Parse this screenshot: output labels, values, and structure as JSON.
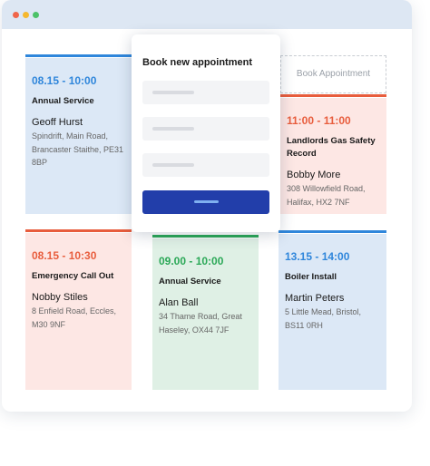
{
  "window": {
    "dots": [
      {
        "name": "close-dot",
        "color": "#f0654a"
      },
      {
        "name": "minimize-dot",
        "color": "#f5b82e"
      },
      {
        "name": "maximize-dot",
        "color": "#4cc268"
      }
    ]
  },
  "appointments": [
    {
      "time": "08.15 - 10:00",
      "service": "Annual Service",
      "name": "Geoff Hurst",
      "address": "Spindrift, Main Road, Brancaster Staithe, PE31 8BP",
      "accent": "#2f86db",
      "bg": "#dce8f6"
    },
    {
      "time": "11:00 - 11:00",
      "service": "Landlords Gas Safety Record",
      "name": "Bobby More",
      "address": "308 Willowfield Road, Halifax, HX2 7NF",
      "accent": "#e85d3d",
      "bg": "#fde7e4"
    },
    {
      "time": "08.15 - 10:30",
      "service": "Emergency Call Out",
      "name": "Nobby Stiles",
      "address": "8 Enfield Road, Eccles, M30 9NF",
      "accent": "#e85d3d",
      "bg": "#fde7e4"
    },
    {
      "time": "09.00 - 10:00",
      "service": "Annual Service",
      "name": "Alan Ball",
      "address": "34 Thame Road, Great Haseley, OX44 7JF",
      "accent": "#2ba857",
      "bg": "#dff0e5"
    },
    {
      "time": "13.15 - 14:00",
      "service": "Boiler Install",
      "name": "Martin Peters",
      "address": "5 Little Mead, Bristol, BS11 0RH",
      "accent": "#2f86db",
      "bg": "#dce8f6"
    }
  ],
  "placeholder_slot": {
    "label": "Book Appointment"
  },
  "modal": {
    "title": "Book new appointment",
    "field_count": 3
  }
}
